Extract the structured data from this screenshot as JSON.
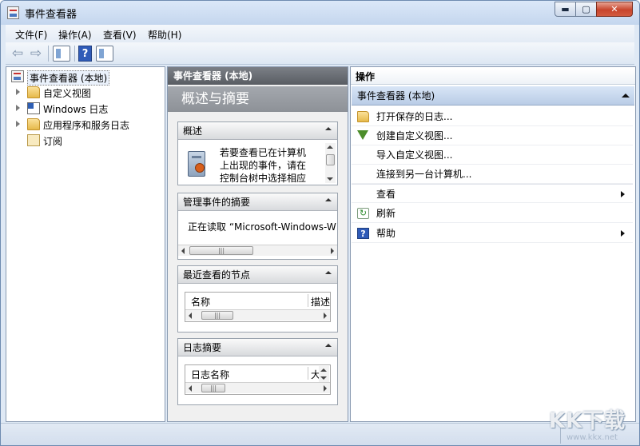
{
  "window": {
    "title": "事件查看器",
    "min_glyph": "▬",
    "max_glyph": "▢",
    "close_glyph": "✕"
  },
  "menu": [
    "文件(F)",
    "操作(A)",
    "查看(V)",
    "帮助(H)"
  ],
  "toolbar": {
    "help_glyph": "?"
  },
  "tree": {
    "root": "事件查看器 (本地)",
    "items": [
      "自定义视图",
      "Windows 日志",
      "应用程序和服务日志",
      "订阅"
    ]
  },
  "middle": {
    "header": "事件查看器 (本地)",
    "banner": "概述与摘要",
    "overview": {
      "title": "概述",
      "text_lines": [
        "若要查看已在计算机",
        "上出现的事件，请在",
        "控制台树中选择相应"
      ]
    },
    "managed": {
      "title": "管理事件的摘要",
      "text": "正在读取 “Microsoft-Windows-W"
    },
    "recent": {
      "title": "最近查看的节点",
      "col1": "名称",
      "col2": "描述"
    },
    "logsummary": {
      "title": "日志摘要",
      "col1": "日志名称",
      "col2": "大"
    }
  },
  "right": {
    "header": "操作",
    "group": "事件查看器 (本地)",
    "actions": [
      "打开保存的日志...",
      "创建自定义视图...",
      "导入自定义视图...",
      "连接到另一台计算机...",
      "查看",
      "刷新",
      "帮助"
    ]
  },
  "watermark": {
    "text": "KK下载",
    "url": "www.kkx.net"
  },
  "icons": [
    "event-viewer-icon",
    "back-arrow-icon",
    "forward-arrow-icon",
    "show-hide-tree-icon",
    "help-icon",
    "show-hide-action-icon",
    "folder-icon",
    "windows-log-icon",
    "subscription-icon",
    "open-log-icon",
    "filter-icon",
    "refresh-icon"
  ]
}
